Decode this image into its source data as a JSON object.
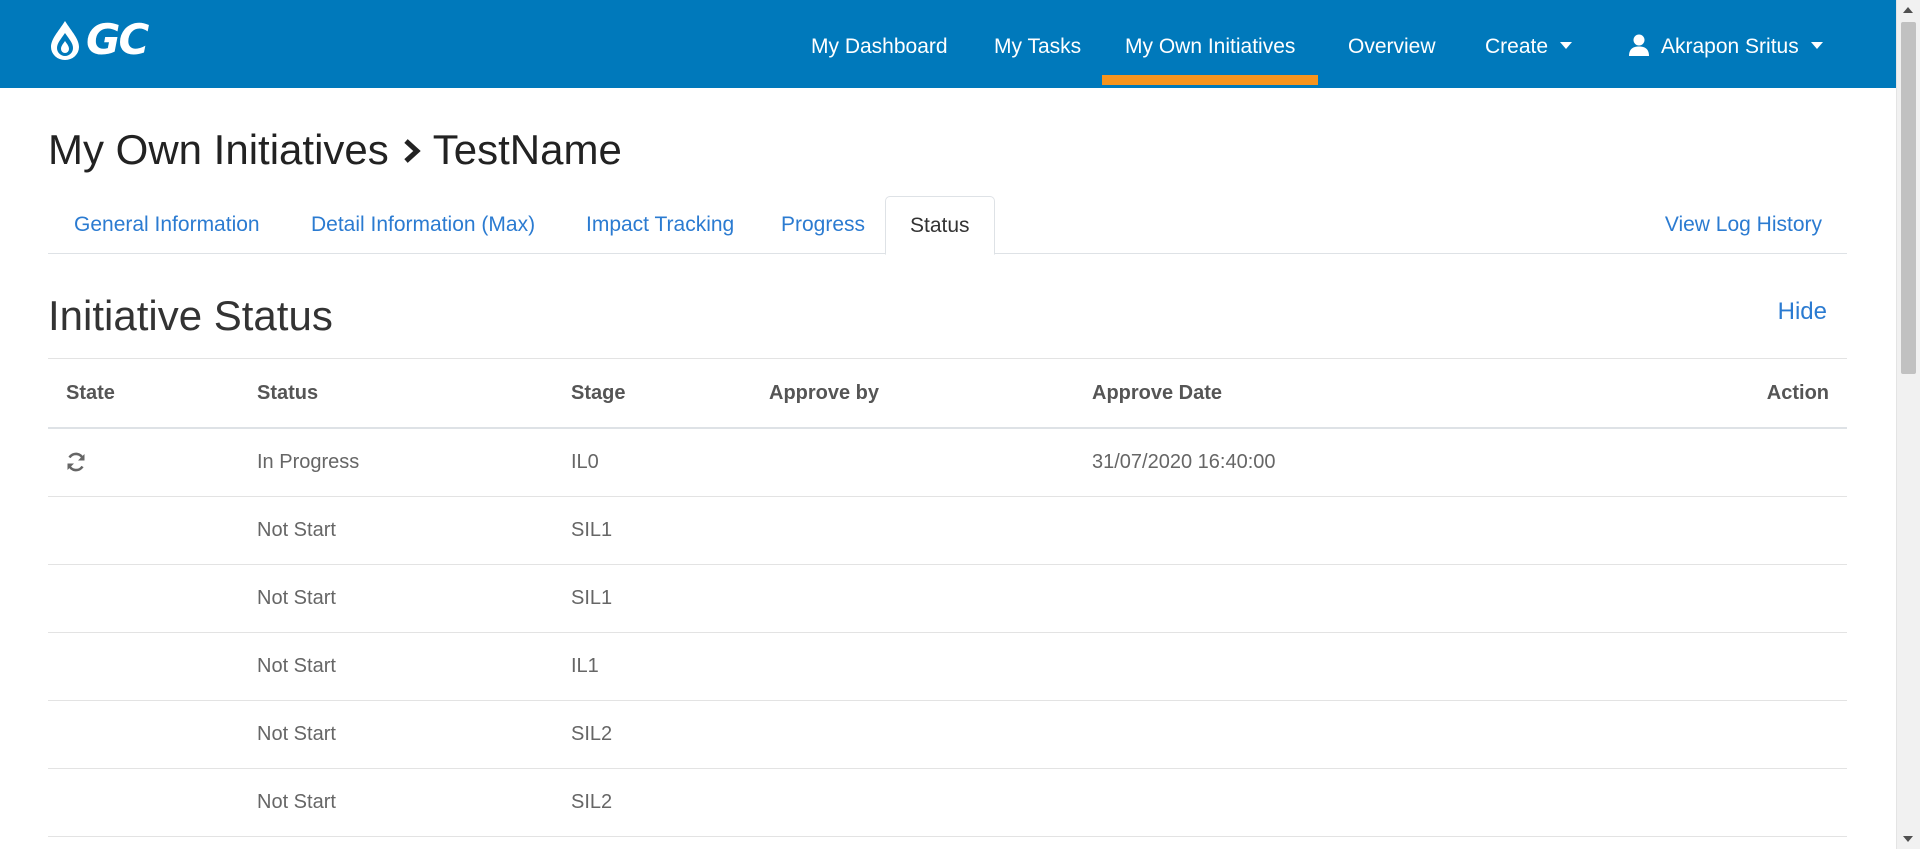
{
  "brand": {
    "logo_text": "GC"
  },
  "nav": {
    "items": [
      {
        "label": "My Dashboard"
      },
      {
        "label": "My Tasks"
      },
      {
        "label": "My Own Initiatives",
        "active": true
      },
      {
        "label": "Overview"
      },
      {
        "label": "Create",
        "dropdown": true
      }
    ],
    "user": {
      "name": "Akrapon Sritus",
      "icon": "user-icon"
    },
    "accent_color": "#f7941d",
    "background_color": "#0079bb"
  },
  "breadcrumb": {
    "parent": "My Own Initiatives",
    "current": "TestName",
    "separator_icon": "chevron-right-icon"
  },
  "tabs": {
    "items": [
      {
        "label": "General Information"
      },
      {
        "label": "Detail Information (Max)"
      },
      {
        "label": "Impact Tracking"
      },
      {
        "label": "Progress"
      },
      {
        "label": "Status",
        "active": true
      }
    ],
    "view_log_label": "View Log History"
  },
  "section": {
    "title": "Initiative Status",
    "hide_label": "Hide"
  },
  "table": {
    "headers": {
      "state": "State",
      "status": "Status",
      "stage": "Stage",
      "approve_by": "Approve by",
      "approve_date": "Approve Date",
      "action": "Action"
    },
    "rows": [
      {
        "state_icon": "sync-icon",
        "status": "In Progress",
        "stage": "IL0",
        "approve_by": "",
        "approve_date": "31/07/2020 16:40:00",
        "action": ""
      },
      {
        "state_icon": "",
        "status": "Not Start",
        "stage": "SIL1",
        "approve_by": "",
        "approve_date": "",
        "action": ""
      },
      {
        "state_icon": "",
        "status": "Not Start",
        "stage": "SIL1",
        "approve_by": "",
        "approve_date": "",
        "action": ""
      },
      {
        "state_icon": "",
        "status": "Not Start",
        "stage": "IL1",
        "approve_by": "",
        "approve_date": "",
        "action": ""
      },
      {
        "state_icon": "",
        "status": "Not Start",
        "stage": "SIL2",
        "approve_by": "",
        "approve_date": "",
        "action": ""
      },
      {
        "state_icon": "",
        "status": "Not Start",
        "stage": "SIL2",
        "approve_by": "",
        "approve_date": "",
        "action": ""
      }
    ]
  }
}
